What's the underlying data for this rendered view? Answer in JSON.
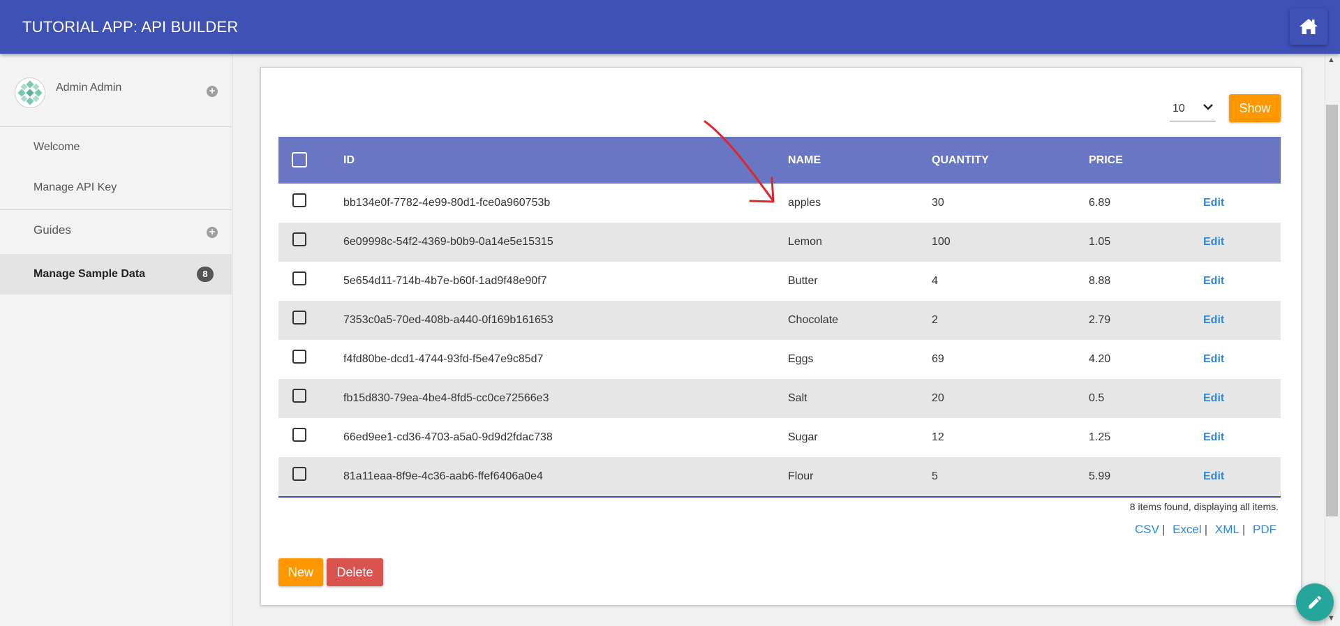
{
  "header": {
    "title": "TUTORIAL APP: API BUILDER",
    "home_icon": "home-icon"
  },
  "sidebar": {
    "profile": {
      "name": "Admin Admin",
      "avatar_icon": "avatar-icon",
      "expand_icon": "plus-circle-icon"
    },
    "items": [
      {
        "label": "Welcome"
      },
      {
        "label": "Manage API Key"
      },
      {
        "label": "Guides",
        "expand_icon": "plus-circle-icon"
      },
      {
        "label": "Manage Sample Data",
        "badge": "8",
        "active": true
      }
    ]
  },
  "toolbar": {
    "page_size": "10",
    "show_label": "Show"
  },
  "table": {
    "columns": [
      "ID",
      "NAME",
      "QUANTITY",
      "PRICE"
    ],
    "edit_label": "Edit",
    "rows": [
      {
        "id": "bb134e0f-7782-4e99-80d1-fce0a960753b",
        "name": "apples",
        "quantity": "30",
        "price": "6.89"
      },
      {
        "id": "6e09998c-54f2-4369-b0b9-0a14e5e15315",
        "name": "Lemon",
        "quantity": "100",
        "price": "1.05"
      },
      {
        "id": "5e654d11-714b-4b7e-b60f-1ad9f48e90f7",
        "name": "Butter",
        "quantity": "4",
        "price": "8.88"
      },
      {
        "id": "7353c0a5-70ed-408b-a440-0f169b161653",
        "name": "Chocolate",
        "quantity": "2",
        "price": "2.79"
      },
      {
        "id": "f4fd80be-dcd1-4744-93fd-f5e47e9c85d7",
        "name": "Eggs",
        "quantity": "69",
        "price": "4.20"
      },
      {
        "id": "fb15d830-79ea-4be4-8fd5-cc0ce72566e3",
        "name": "Salt",
        "quantity": "20",
        "price": "0.5"
      },
      {
        "id": "66ed9ee1-cd36-4703-a5a0-9d9d2fdac738",
        "name": "Sugar",
        "quantity": "12",
        "price": "1.25"
      },
      {
        "id": "81a11eaa-8f9e-4c36-aab6-ffef6406a0e4",
        "name": "Flour",
        "quantity": "5",
        "price": "5.99"
      }
    ],
    "summary": "8 items found, displaying all items.",
    "exports": [
      "CSV",
      "Excel",
      "XML",
      "PDF"
    ]
  },
  "actions": {
    "new_label": "New",
    "delete_label": "Delete"
  },
  "fab": {
    "icon": "pencil-icon"
  },
  "colors": {
    "header": "#3f51b5",
    "table_header": "#6876c4",
    "orange": "#ff9800",
    "red": "#d9534f",
    "link": "#2b8ae0",
    "fab": "#26a69a",
    "annotation": "#e0262b"
  }
}
